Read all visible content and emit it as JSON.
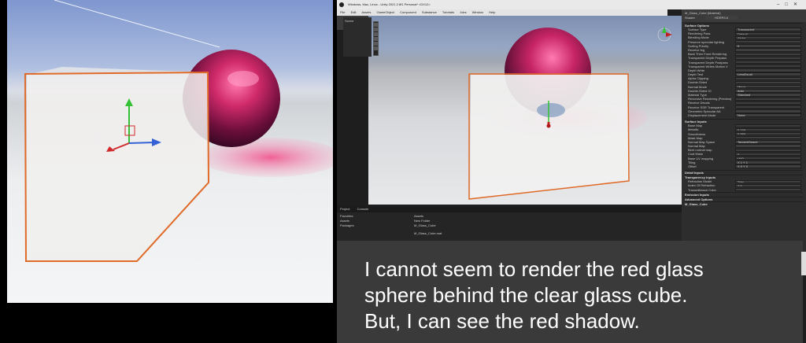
{
  "editor": {
    "window_title": "Windows, Mac, Linux - Unity 2021.2.8f1 Personal* <DX12>",
    "menu": [
      "File",
      "Edit",
      "Assets",
      "GameObject",
      "Component",
      "Substance",
      "Tutorials",
      "Jobs",
      "Window",
      "Help"
    ],
    "hierarchy": [
      "Scene"
    ]
  },
  "project_panel": {
    "tabs": [
      "Project",
      "Console"
    ],
    "tree": [
      "Favorites",
      "Assets",
      "Packages"
    ],
    "breadcrumb": "Assets",
    "files": [
      "New Folder",
      "M_Glass_Cube"
    ],
    "footer": "M_Glass_Cube.mat"
  },
  "inspector": {
    "material_name": "M_Glass_Cube (Material)",
    "shader_label": "Shader",
    "shader_value": "HDRP/Lit",
    "surface_options_title": "Surface Options",
    "surface_options": [
      {
        "label": "Surface Type",
        "value": "Transparent"
      },
      {
        "label": "Rendering Pass",
        "value": "Default"
      },
      {
        "label": "Blending Mode",
        "value": "Alpha"
      },
      {
        "label": "Preserve specular lighting",
        "value": ""
      },
      {
        "label": "Sorting Priority",
        "value": "0"
      },
      {
        "label": "Receive fog",
        "value": ""
      },
      {
        "label": "Back Then Front Rendering",
        "value": ""
      },
      {
        "label": "Transparent Depth Prepass",
        "value": ""
      },
      {
        "label": "Transparent Depth Postpass",
        "value": ""
      },
      {
        "label": "Transparent Writes Motion V",
        "value": ""
      },
      {
        "label": "Depth Write",
        "value": ""
      },
      {
        "label": "Depth Test",
        "value": "LessEqual"
      },
      {
        "label": "Alpha Clipping",
        "value": ""
      },
      {
        "label": "Double-Sided",
        "value": ""
      },
      {
        "label": "Normal Mode",
        "value": "Mirror"
      },
      {
        "label": "Double-Sided GI",
        "value": "Auto"
      },
      {
        "label": "Material Type",
        "value": "Standard"
      },
      {
        "label": "Recursive Rendering (Preview)",
        "value": ""
      },
      {
        "label": "Receive Decals",
        "value": ""
      },
      {
        "label": "Receive SSR Transparent",
        "value": ""
      },
      {
        "label": "Geometric Specular AA",
        "value": ""
      },
      {
        "label": "Displacement Mode",
        "value": "None"
      }
    ],
    "surface_inputs_title": "Surface Inputs",
    "surface_inputs": [
      {
        "label": "Base Map",
        "value": ""
      },
      {
        "label": "Metallic",
        "value": "0.198"
      },
      {
        "label": "Smoothness",
        "value": "0.988"
      },
      {
        "label": "Mask Map",
        "value": ""
      },
      {
        "label": "Normal Map Space",
        "value": "TangentSpace"
      },
      {
        "label": "Normal Map",
        "value": ""
      },
      {
        "label": "Bent normal map",
        "value": ""
      },
      {
        "label": "Coat Mask",
        "value": "0"
      },
      {
        "label": "Base UV mapping",
        "value": "UV0"
      },
      {
        "label": "Tiling",
        "value": "X 1    Y 1"
      },
      {
        "label": "Offset",
        "value": "X 0    Y 0"
      }
    ],
    "detail_inputs_title": "Detail Inputs",
    "transparency_title": "Transparency Inputs",
    "transparency": [
      {
        "label": "Refraction Model",
        "value": "Thin"
      },
      {
        "label": "Index Of Refraction",
        "value": "2.5"
      },
      {
        "label": "Transmittance Color",
        "value": ""
      }
    ],
    "emission_title": "Emission Inputs",
    "advanced_title": "Advanced Options",
    "footer_asset": "M_Glass_Cube"
  },
  "caption": "I cannot seem to render the red glass\nsphere behind the clear glass cube.\nBut, I can see the red shadow."
}
